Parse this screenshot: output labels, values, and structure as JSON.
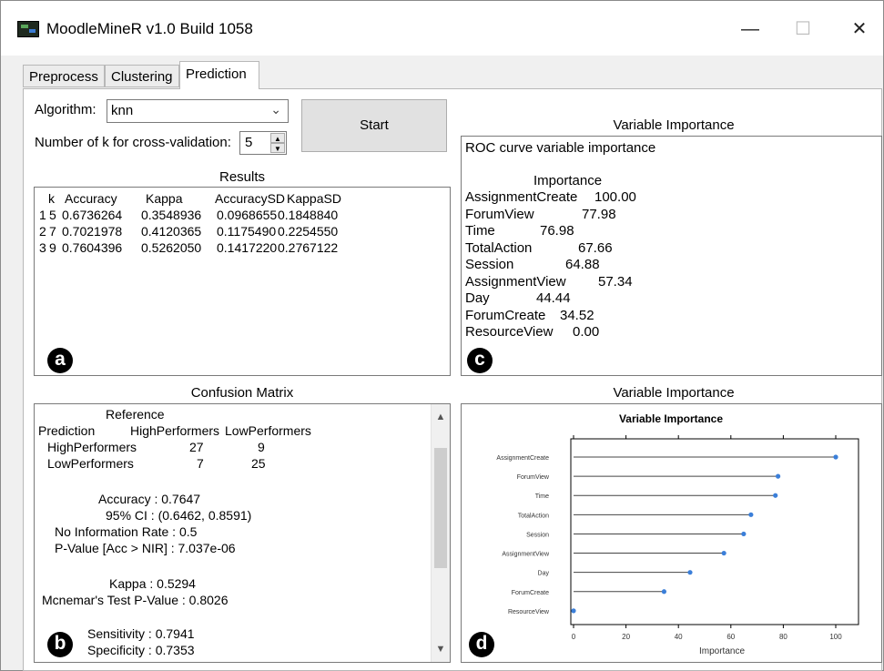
{
  "window": {
    "title": "MoodleMineR v1.0 Build 1058",
    "controls": [
      "—",
      "☐",
      "✕"
    ]
  },
  "tabs": [
    {
      "label": "Preprocess"
    },
    {
      "label": "Clustering"
    },
    {
      "label": "Prediction",
      "active": true
    }
  ],
  "form": {
    "algorithm_label": "Algorithm:",
    "algorithm_value": "knn",
    "k_label": "Number of k for cross-validation:",
    "k_value": "5",
    "start_label": "Start"
  },
  "results": {
    "title": "Results",
    "columns": [
      "k",
      "Accuracy",
      "Kappa",
      "AccuracySD",
      "KappaSD"
    ],
    "rows": [
      [
        "1",
        "5",
        "0.6736264",
        "0.3548936",
        "0.0968655",
        "0.1848840"
      ],
      [
        "2",
        "7",
        "0.7021978",
        "0.4120365",
        "0.1175490",
        "0.2254550"
      ],
      [
        "3",
        "9",
        "0.7604396",
        "0.5262050",
        "0.1417220",
        "0.2767122"
      ]
    ],
    "badge": "a"
  },
  "roc": {
    "title": "Variable Importance",
    "heading": "ROC curve variable importance",
    "importance_header": "Importance",
    "items": [
      {
        "name": "AssignmentCreate",
        "value": "100.00"
      },
      {
        "name": "ForumView",
        "value": "77.98"
      },
      {
        "name": "Time",
        "value": "76.98"
      },
      {
        "name": "TotalAction",
        "value": "67.66"
      },
      {
        "name": "Session",
        "value": "64.88"
      },
      {
        "name": "AssignmentView",
        "value": "57.34"
      },
      {
        "name": "Day",
        "value": "44.44"
      },
      {
        "name": "ForumCreate",
        "value": "34.52"
      },
      {
        "name": "ResourceView",
        "value": "0.00"
      }
    ],
    "badge": "c"
  },
  "confusion": {
    "title": "Confusion Matrix",
    "reference_label": "Reference",
    "prediction_label": "Prediction",
    "col_high": "HighPerformers",
    "col_low": "LowPerformers",
    "rows": [
      {
        "label": "HighPerformers",
        "high": "27",
        "low": "9"
      },
      {
        "label": "LowPerformers",
        "high": "7",
        "low": "25"
      }
    ],
    "stats": {
      "accuracy": "Accuracy : 0.7647",
      "ci": "95% CI : (0.6462, 0.8591)",
      "nir": "No Information Rate : 0.5",
      "pvalue": "P-Value [Acc > NIR] : 7.037e-06",
      "kappa": "Kappa : 0.5294",
      "mcnemar": "Mcnemar's Test P-Value : 0.8026",
      "sensitivity": "Sensitivity : 0.7941",
      "specificity": "Specificity : 0.7353"
    },
    "badge": "b"
  },
  "plot": {
    "panel_title": "Variable Importance",
    "badge": "d",
    "chart_data": {
      "type": "scatter",
      "title": "Variable Importance",
      "xlabel": "Importance",
      "ylabel": "",
      "xlim": [
        0,
        100
      ],
      "xticks": [
        "0",
        "20",
        "40",
        "60",
        "80",
        "100"
      ],
      "categories": [
        "AssignmentCreate",
        "ForumView",
        "Time",
        "TotalAction",
        "Session",
        "AssignmentView",
        "Day",
        "ForumCreate",
        "ResourceView"
      ],
      "values": [
        100.0,
        77.98,
        76.98,
        67.66,
        64.88,
        57.34,
        44.44,
        34.52,
        0.0
      ],
      "point_color": "#3b7fd9",
      "line_color": "#444444"
    }
  }
}
